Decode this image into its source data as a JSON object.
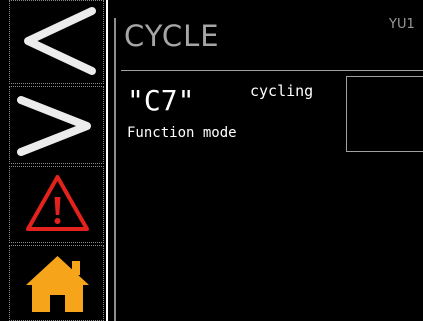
{
  "screen": {
    "title": "CYCLE",
    "device_id": "YU1",
    "code": "\"C7\"",
    "state": "cycling",
    "mode_label": "Function mode",
    "value_box_text": ""
  },
  "sidebar": {
    "buttons": [
      {
        "name": "previous",
        "icon": "chevron-left-icon"
      },
      {
        "name": "next",
        "icon": "chevron-right-icon"
      },
      {
        "name": "alarm",
        "icon": "warning-triangle-icon"
      },
      {
        "name": "home",
        "icon": "home-icon"
      }
    ]
  },
  "colors": {
    "background": "#000000",
    "text": "#ffffff",
    "title": "#a6a6a6",
    "chevron": "#ececec",
    "warning": "#e4221d",
    "home": "#f6a51a",
    "divider": "#a0a0a0"
  }
}
